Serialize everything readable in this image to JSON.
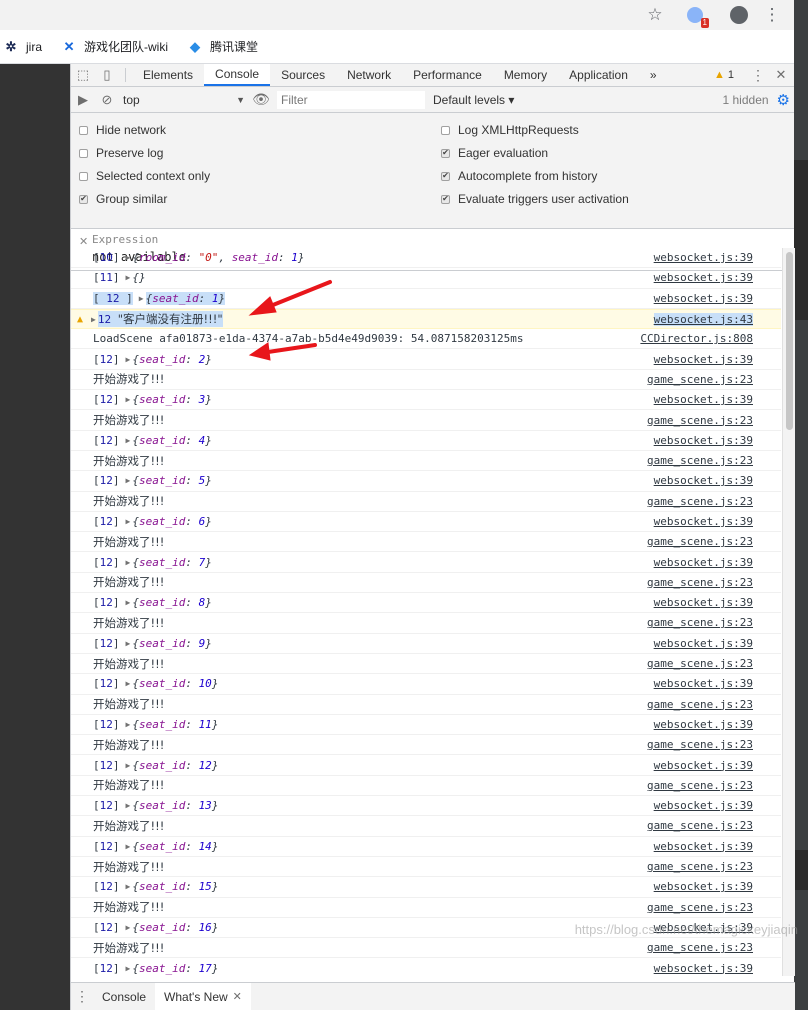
{
  "browser": {
    "bookmarks": [
      {
        "label": "jira",
        "icon": "jira-icon"
      },
      {
        "label": "游戏化团队-wiki",
        "icon": "confluence-icon"
      },
      {
        "label": "腾讯课堂",
        "icon": "tencent-classroom-icon"
      }
    ],
    "extension_badge": "1"
  },
  "devtools": {
    "tabs": [
      "Elements",
      "Console",
      "Sources",
      "Network",
      "Performance",
      "Memory",
      "Application"
    ],
    "active_tab": "Console",
    "more_tabs": "»",
    "warning_count": "1",
    "toolbar": {
      "context": "top",
      "filter_placeholder": "Filter",
      "levels": "Default levels ▾",
      "hidden": "1 hidden"
    },
    "settings_left": [
      {
        "label": "Hide network",
        "checked": false
      },
      {
        "label": "Preserve log",
        "checked": false
      },
      {
        "label": "Selected context only",
        "checked": false
      },
      {
        "label": "Group similar",
        "checked": true
      }
    ],
    "settings_right": [
      {
        "label": "Log XMLHttpRequests",
        "checked": false
      },
      {
        "label": "Eager evaluation",
        "checked": true
      },
      {
        "label": "Autocomplete from history",
        "checked": true
      },
      {
        "label": "Evaluate triggers user activation",
        "checked": true
      }
    ],
    "expression": {
      "label": "Expression",
      "value": "not available"
    },
    "drawer": {
      "tabs": [
        "Console",
        "What's New"
      ],
      "active": "What's New"
    }
  },
  "console": {
    "special_rows": {
      "row0": {
        "idx": "10",
        "key1": "room_id",
        "val1": "\"0\"",
        "key2": "seat_id",
        "val2": "1",
        "source": "websocket.js:39"
      },
      "row1": {
        "idx": "11",
        "text": "{}",
        "source": "websocket.js:39"
      },
      "row2": {
        "idx": "12",
        "key": "seat_id",
        "val": "1",
        "source": "websocket.js:39"
      },
      "warn": {
        "idx": "12",
        "text": "\"客户端没有注册!!!\"",
        "source": "websocket.js:43"
      },
      "load": {
        "text": "LoadScene afa01873-e1da-4374-a7ab-b5d4e49d9039: 54.087158203125ms",
        "source": "CCDirector.js:808"
      }
    },
    "repeated_idx": "12",
    "seat_key": "seat_id",
    "seat_values": [
      "2",
      "3",
      "4",
      "5",
      "6",
      "7",
      "8",
      "9",
      "10",
      "11",
      "12",
      "13",
      "14",
      "15",
      "16",
      "17"
    ],
    "ws_source": "websocket.js:39",
    "start_message": "开始游戏了!!!",
    "start_source": "game_scene.js:23"
  },
  "watermark": "https://blog.csdn.net/themagickeyjiaqin",
  "colors": {
    "accent": "#1a73e8",
    "warning": "#e8a400",
    "annotation_arrow": "#e8161b"
  }
}
